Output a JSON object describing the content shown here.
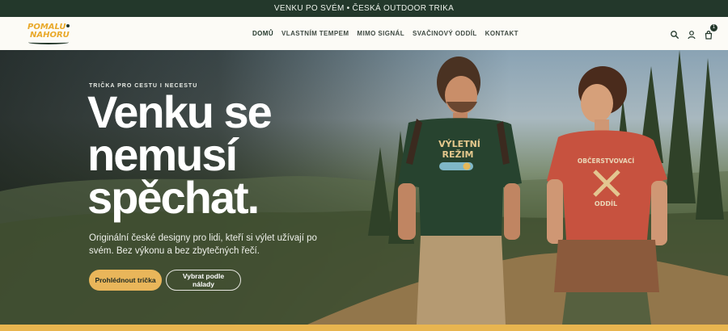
{
  "announcement": {
    "text": "VENKU PO SVÉM • ČESKÁ OUTDOOR TRIKA"
  },
  "logo": {
    "line1": "POMALU",
    "line2": "NAHORU"
  },
  "nav": {
    "items": [
      {
        "label": "DOMŮ",
        "active": true
      },
      {
        "label": "VLASTNÍM TEMPEM",
        "active": false
      },
      {
        "label": "MIMO SIGNÁL",
        "active": false
      },
      {
        "label": "SVAČINOVÝ ODDÍL",
        "active": false
      },
      {
        "label": "KONTAKT",
        "active": false
      }
    ]
  },
  "header_icons": {
    "search": "search-icon",
    "account": "user-icon",
    "cart": "cart-icon",
    "cart_count": "1"
  },
  "hero": {
    "eyebrow": "TRIČKA PRO CESTU I NECESTU",
    "headline": "Venku se nemusí spěchat.",
    "subtext": "Originální české designy pro lidi, kteří si výlet užívají po svém. Bez výkonu a bez zbytečných řečí.",
    "primary_button": "Prohlédnout trička",
    "secondary_button": "Vybrat podle nálady",
    "shirt_left_text_1": "VÝLETNÍ",
    "shirt_left_text_2": "REŽIM",
    "shirt_right_text_1": "OBČERSTVOVACÍ",
    "shirt_right_text_2": "ODDÍL"
  },
  "colors": {
    "dark_green": "#23382b",
    "accent_yellow": "#e9b65a",
    "page_bg": "#fcfbf6"
  }
}
